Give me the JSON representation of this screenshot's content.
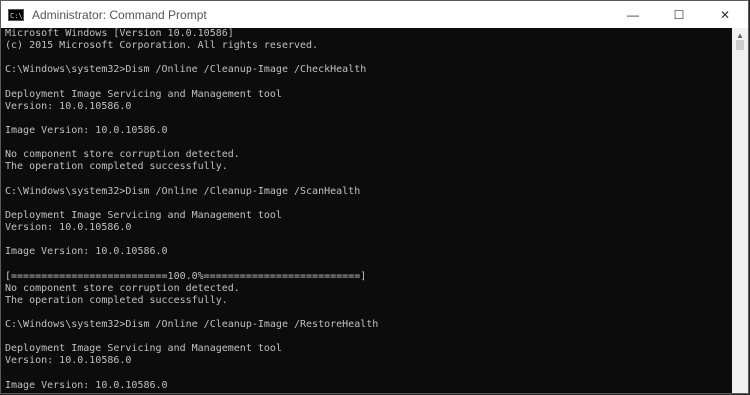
{
  "window": {
    "title": "Administrator: Command Prompt",
    "icon_text": "C:\\"
  },
  "controls": {
    "minimize": "—",
    "maximize": "☐",
    "close": "✕"
  },
  "scrollbar": {
    "up_arrow": "▲"
  },
  "console": {
    "lines": [
      "Microsoft Windows [Version 10.0.10586]",
      "(c) 2015 Microsoft Corporation. All rights reserved.",
      "",
      "C:\\Windows\\system32>Dism /Online /Cleanup-Image /CheckHealth",
      "",
      "Deployment Image Servicing and Management tool",
      "Version: 10.0.10586.0",
      "",
      "Image Version: 10.0.10586.0",
      "",
      "No component store corruption detected.",
      "The operation completed successfully.",
      "",
      "C:\\Windows\\system32>Dism /Online /Cleanup-Image /ScanHealth",
      "",
      "Deployment Image Servicing and Management tool",
      "Version: 10.0.10586.0",
      "",
      "Image Version: 10.0.10586.0",
      "",
      "[==========================100.0%==========================]",
      "No component store corruption detected.",
      "The operation completed successfully.",
      "",
      "C:\\Windows\\system32>Dism /Online /Cleanup-Image /RestoreHealth",
      "",
      "Deployment Image Servicing and Management tool",
      "Version: 10.0.10586.0",
      "",
      "Image Version: 10.0.10586.0"
    ]
  }
}
